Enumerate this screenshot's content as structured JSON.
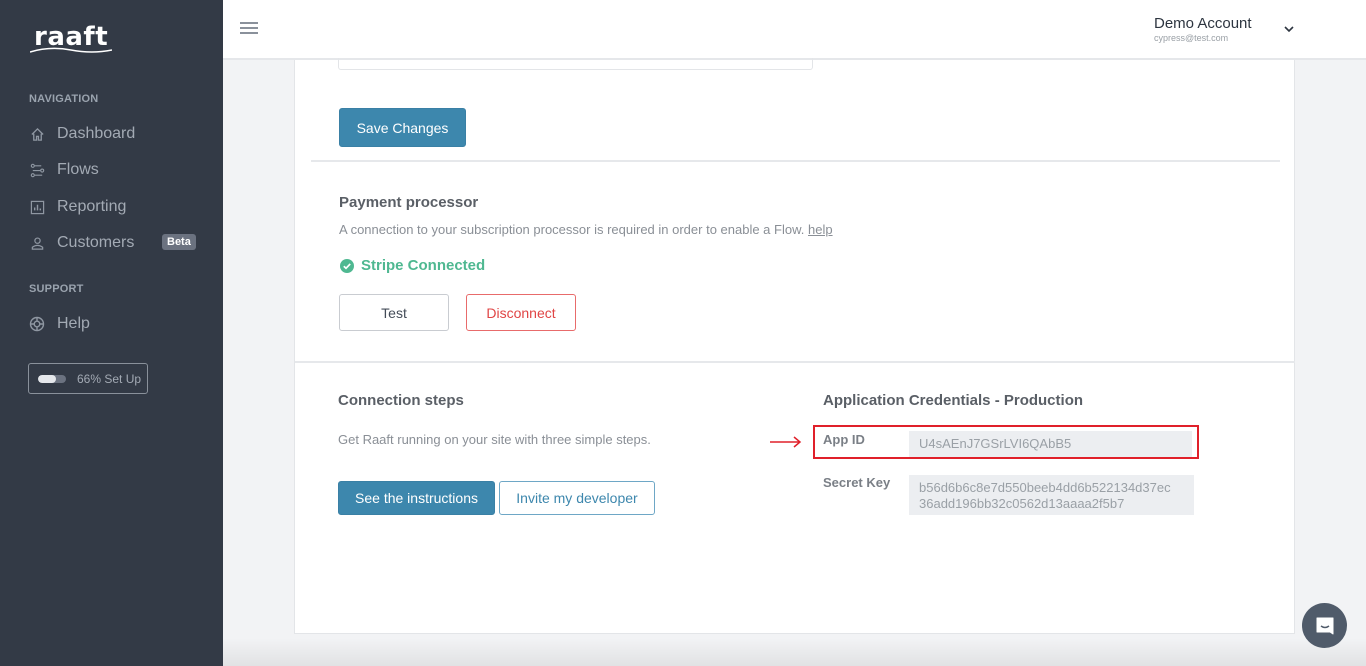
{
  "app": {
    "logo_text": "raaft"
  },
  "sidebar": {
    "navigation_heading": "NAVIGATION",
    "items": [
      {
        "label": "Dashboard",
        "icon": "home-icon"
      },
      {
        "label": "Flows",
        "icon": "flows-icon"
      },
      {
        "label": "Reporting",
        "icon": "chart-icon"
      },
      {
        "label": "Customers",
        "icon": "user-icon",
        "badge": "Beta"
      }
    ],
    "support_heading": "SUPPORT",
    "support_items": [
      {
        "label": "Help",
        "icon": "lifebuoy-icon"
      }
    ],
    "setup": {
      "label": "66% Set Up",
      "progress_percent": 66
    }
  },
  "header": {
    "menu_icon": "hamburger-icon",
    "account_name": "Demo Account",
    "account_email": "cypress@test.com"
  },
  "main": {
    "save_button": "Save Changes",
    "payment": {
      "title": "Payment processor",
      "description": "A connection to your subscription processor is required in order to enable a Flow.",
      "help_link": "help",
      "status": "Stripe Connected",
      "status_color": "#4fb891",
      "test_button": "Test",
      "disconnect_button": "Disconnect"
    },
    "connection": {
      "title": "Connection steps",
      "description": "Get Raaft running on your site with three simple steps.",
      "instructions_button": "See the instructions",
      "invite_button": "Invite my developer"
    },
    "credentials": {
      "title": "Application Credentials - Production",
      "app_id_label": "App ID",
      "app_id_value": "U4sAEnJ7GSrLVI6QAbB5",
      "secret_key_label": "Secret Key",
      "secret_key_line1": "b56d6b6c8e7d550beeb4dd6b522134d37ec",
      "secret_key_line2": "36add196bb32c0562d13aaaa2f5b7"
    }
  },
  "colors": {
    "primary": "#3d87ad",
    "sidebar": "#333a46",
    "danger": "#e04545",
    "highlight": "#e0202a"
  }
}
